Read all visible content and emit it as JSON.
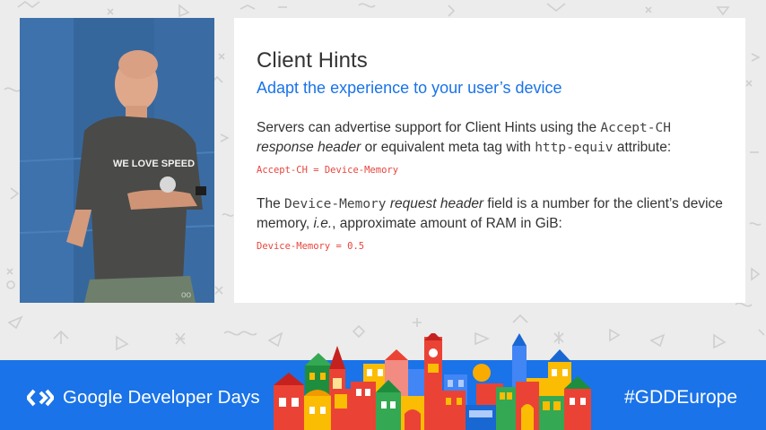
{
  "slide": {
    "title": "Client Hints",
    "subtitle": "Adapt the experience to your user’s device",
    "para1": {
      "t1": "Servers can advertise support for Client Hints using the ",
      "code_a": "Accept-CH",
      "em": "response header",
      "t2": " or equivalent meta tag with ",
      "code_b": "http-equiv",
      "t3": " attribute:"
    },
    "code1": "Accept-CH = Device-Memory",
    "para2": {
      "t1": "The ",
      "code_a": "Device-Memory",
      "em": "request header",
      "t2": " field is a number for the client’s device memory, ",
      "em2": "i.e.",
      "t3": ", approximate amount of RAM in GiB:"
    },
    "code2": "Device-Memory = 0.5"
  },
  "video": {
    "shirt_text": "WE LOVE SPEED"
  },
  "footer": {
    "brand": "Google Developer Days",
    "hashtag": "#GDDEurope",
    "color": "#1a73e8"
  },
  "icons": {
    "brand": "gdd-chevron-logo",
    "background": "doodle-pattern",
    "illustration": "colorful-city-skyline"
  }
}
